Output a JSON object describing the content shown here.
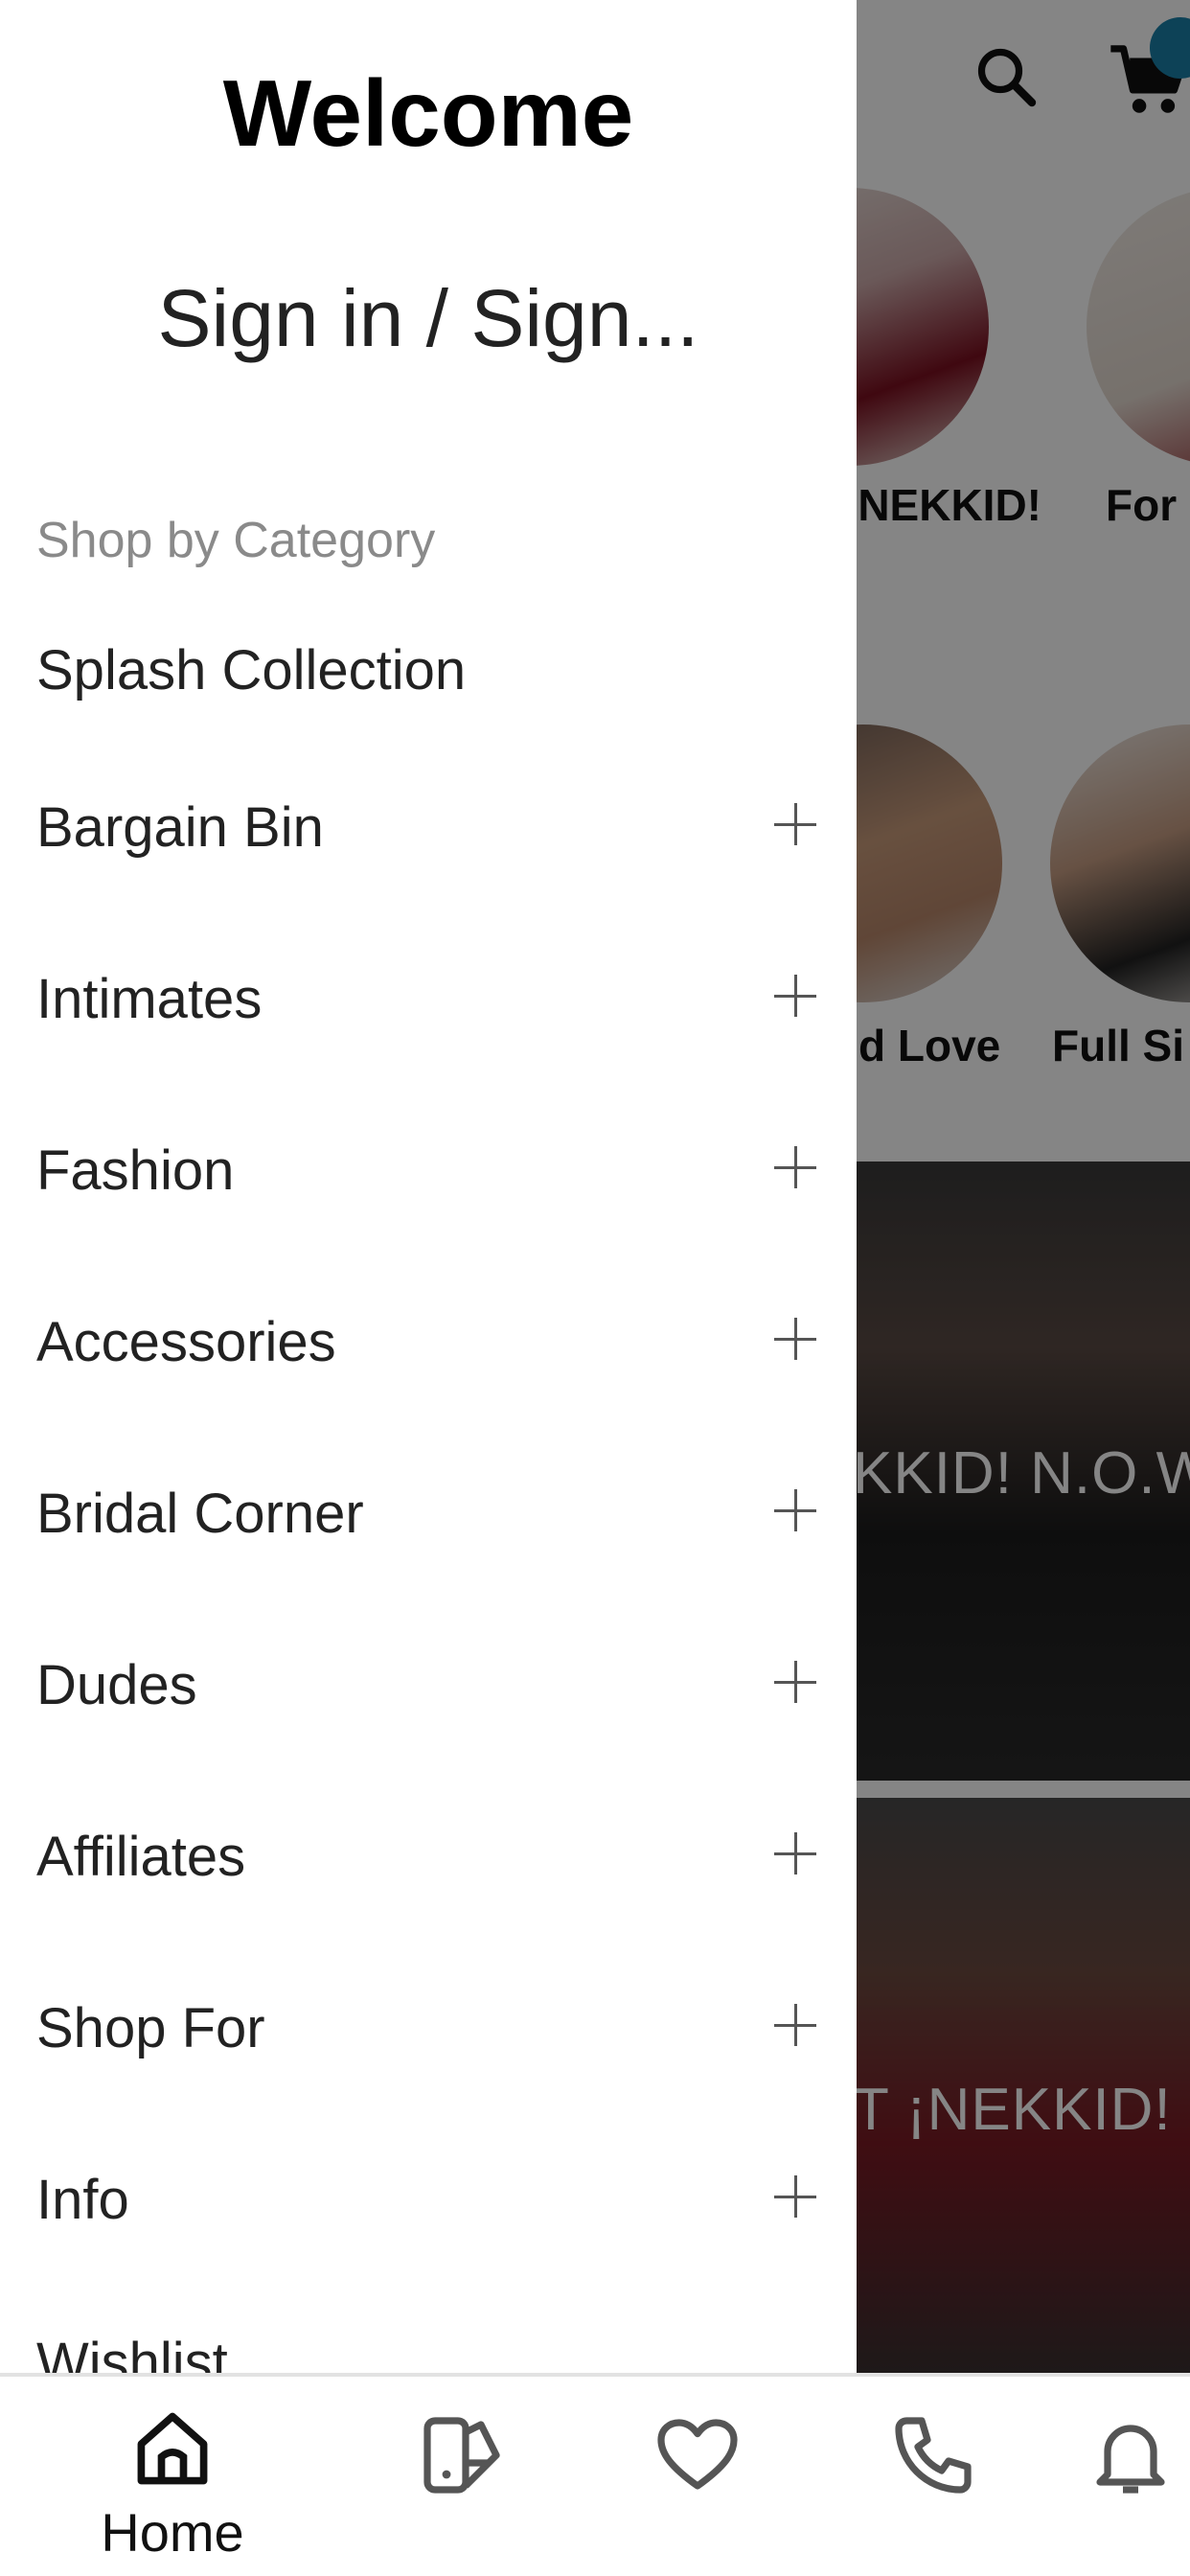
{
  "drawer": {
    "title": "Welcome",
    "signin_label": "Sign in / Sign...",
    "section_title": "Shop by Category",
    "items": [
      {
        "label": "Splash Collection",
        "expandable": false
      },
      {
        "label": "Bargain Bin",
        "expandable": true
      },
      {
        "label": "Intimates",
        "expandable": true
      },
      {
        "label": "Fashion",
        "expandable": true
      },
      {
        "label": "Accessories",
        "expandable": true
      },
      {
        "label": "Bridal Corner",
        "expandable": true
      },
      {
        "label": "Dudes",
        "expandable": true
      },
      {
        "label": "Affiliates",
        "expandable": true
      },
      {
        "label": "Shop For",
        "expandable": true
      },
      {
        "label": "Info",
        "expandable": true
      },
      {
        "label": "Wishlist",
        "expandable": false
      }
    ]
  },
  "background": {
    "categories_row1": [
      "¡NEKKID!",
      "For"
    ],
    "categories_row2": [
      "d Love",
      "Full Si"
    ],
    "banners": [
      "KKID! N.O.W.",
      "T ¡NEKKID!"
    ]
  },
  "bottom_nav": {
    "home_label": "Home",
    "icons": [
      "home-icon",
      "catalog-icon",
      "heart-icon",
      "phone-icon",
      "bell-icon"
    ]
  },
  "colors": {
    "scrim": "#000000",
    "drawer_bg": "#ffffff",
    "section_title": "#8a8a8a",
    "cart_badge": "#1a7fa8"
  }
}
